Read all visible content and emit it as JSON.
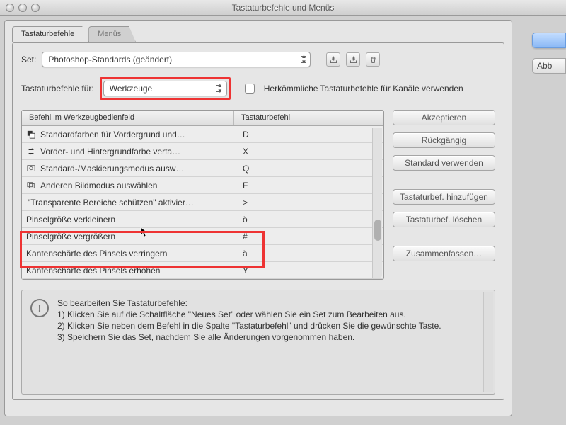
{
  "window": {
    "title": "Tastaturbefehle und Menüs"
  },
  "tabs": {
    "active": "Tastaturbefehle",
    "inactive": "Menüs"
  },
  "setRow": {
    "label": "Set:",
    "value": "Photoshop-Standards (geändert)"
  },
  "forRow": {
    "label": "Tastaturbefehle für:",
    "value": "Werkzeuge",
    "checkboxLabel": "Herkömmliche Tastaturbefehle für Kanäle verwenden"
  },
  "table": {
    "col1": "Befehl im Werkzeugbedienfeld",
    "col2": "Tastaturbefehl",
    "rows": [
      {
        "icon": "swatch",
        "cmd": "Standardfarben für Vordergrund und…",
        "sc": "D"
      },
      {
        "icon": "swap",
        "cmd": "Vorder- und Hintergrundfarbe verta…",
        "sc": "X"
      },
      {
        "icon": "mask",
        "cmd": "Standard-/Maskierungsmodus ausw…",
        "sc": "Q"
      },
      {
        "icon": "screen",
        "cmd": "Anderen Bildmodus auswählen",
        "sc": "F"
      },
      {
        "icon": "",
        "cmd": "\"Transparente Bereiche schützen\" aktivier…",
        "sc": ">"
      },
      {
        "icon": "",
        "cmd": "Pinselgröße verkleinern",
        "sc": "ö"
      },
      {
        "icon": "",
        "cmd": "Pinselgröße vergrößern",
        "sc": "#"
      },
      {
        "icon": "",
        "cmd": "Kantenschärfe des Pinsels verringern",
        "sc": "ä"
      },
      {
        "icon": "",
        "cmd": "Kantenschärfe des Pinsels erhöhen",
        "sc": "Y"
      }
    ]
  },
  "buttons": {
    "accept": "Akzeptieren",
    "undo": "Rückgängig",
    "useDefault": "Standard verwenden",
    "addShortcut": "Tastaturbef. hinzufügen",
    "deleteShortcut": "Tastaturbef. löschen",
    "summarize": "Zusammenfassen…",
    "cancel": "Abb"
  },
  "help": {
    "heading": "So bearbeiten Sie Tastaturbefehle:",
    "line1": "1) Klicken Sie auf die Schaltfläche \"Neues Set\" oder wählen Sie ein Set zum Bearbeiten aus.",
    "line2": "2) Klicken Sie neben dem Befehl in die Spalte \"Tastaturbefehl\" und drücken Sie die gewünschte Taste.",
    "line3": "3) Speichern Sie das Set, nachdem Sie alle Änderungen vorgenommen haben."
  }
}
